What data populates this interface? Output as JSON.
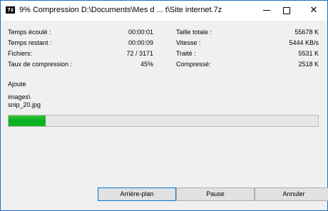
{
  "window": {
    "icon_text": "7z",
    "title": "9% Compression D:\\Documents\\Mes d ... t\\Site internet.7z"
  },
  "stats_left": [
    {
      "label": "Temps écoulé :",
      "value": "00:00:01"
    },
    {
      "label": "Temps restant :",
      "value": "00:00:09"
    },
    {
      "label": "Fichiers:",
      "value": "72 / 3171"
    },
    {
      "label": "Taux de compression :",
      "value": "45%"
    }
  ],
  "stats_right": [
    {
      "label": "Taille totale :",
      "value": "55678 K"
    },
    {
      "label": "Vitesse :",
      "value": "5444 KB/s"
    },
    {
      "label": "Traité :",
      "value": "5531 K"
    },
    {
      "label": "Compressé:",
      "value": "2518 K"
    }
  ],
  "action": {
    "label": "Ajoute",
    "path_line1": "images\\",
    "path_line2": "snip_20.jpg"
  },
  "progress": {
    "fraction": 0.12,
    "color": "#06b025"
  },
  "buttons": {
    "background": "Arrière-plan",
    "pause": "Pause",
    "cancel": "Annuler"
  }
}
